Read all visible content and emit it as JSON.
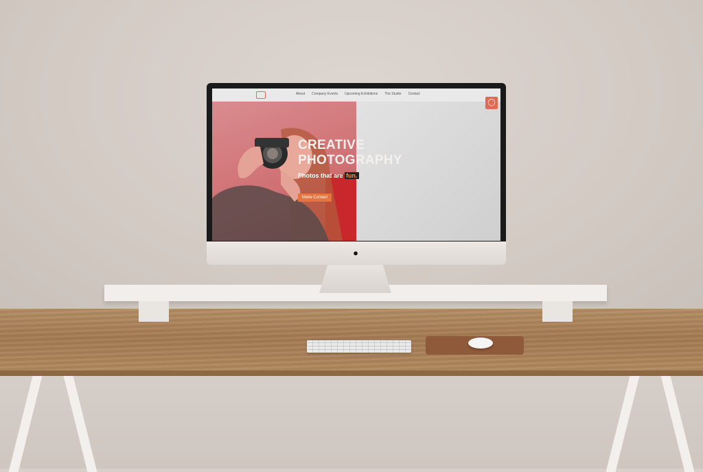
{
  "site": {
    "nav": [
      "About",
      "Company Events",
      "Upcoming Exhibitions",
      "The Studio",
      "Contact"
    ],
    "headline_line1": "CREATIVE",
    "headline_line2": "PHOTOGRAPHY",
    "subtitle_prefix": "Photos that are ",
    "subtitle_highlight": "fun.",
    "cta_label": "Make Contact",
    "instagram_icon": "instagram-icon",
    "logo_icon": "camera-logo-icon"
  },
  "colors": {
    "accent": "#e26a53",
    "button": "#e8733c",
    "hero_overlay": "#cf6f72"
  },
  "scene": {
    "apple_logo": ""
  }
}
